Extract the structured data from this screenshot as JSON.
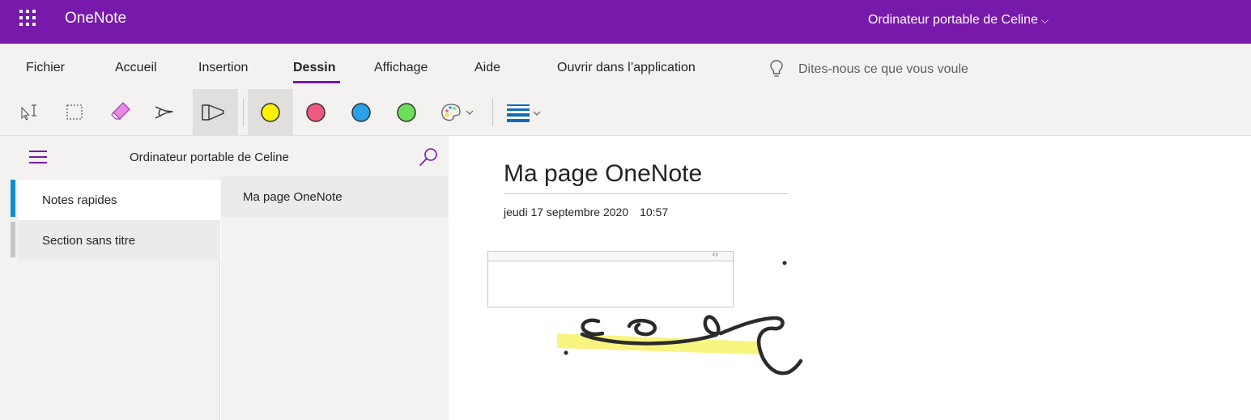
{
  "app": {
    "name": "OneNote",
    "notebook_switcher": "Ordinateur portable de Celine",
    "accent_color": "#7719aa"
  },
  "menu": {
    "tabs": [
      {
        "label": "Fichier"
      },
      {
        "label": "Accueil"
      },
      {
        "label": "Insertion"
      },
      {
        "label": "Dessin",
        "active": true
      },
      {
        "label": "Affichage"
      },
      {
        "label": "Aide"
      },
      {
        "label": "Ouvrir dans l’application"
      }
    ],
    "tell_me_placeholder": "Dites-nous ce que vous voule"
  },
  "toolbar": {
    "tools": [
      "type-select-icon",
      "lasso-select-icon",
      "eraser-icon",
      "pen-icon",
      "highlighter-icon"
    ],
    "colors": [
      {
        "name": "yellow",
        "hex": "#fff100",
        "selected": true
      },
      {
        "name": "pink",
        "hex": "#f05a80"
      },
      {
        "name": "blue",
        "hex": "#29a1e8"
      },
      {
        "name": "green",
        "hex": "#6cdf5a"
      }
    ],
    "extra": [
      "palette-icon",
      "stroke-thickness-icon"
    ]
  },
  "navigation": {
    "notebook_title": "Ordinateur portable de Celine",
    "sections": [
      {
        "label": "Notes rapides",
        "selected": true,
        "color": "#0f8fcf"
      },
      {
        "label": "Section sans titre",
        "color": "#c8c6c4"
      }
    ],
    "pages": [
      {
        "label": "Ma page OneNote",
        "selected": true
      }
    ]
  },
  "page": {
    "title": "Ma page OneNote",
    "date": "jeudi 17 septembre 2020",
    "time": "10:57",
    "note_handle_glyph": "‹›",
    "ink_colors": {
      "pen": "#2b2b2b",
      "highlight": "#f7f26a"
    }
  }
}
